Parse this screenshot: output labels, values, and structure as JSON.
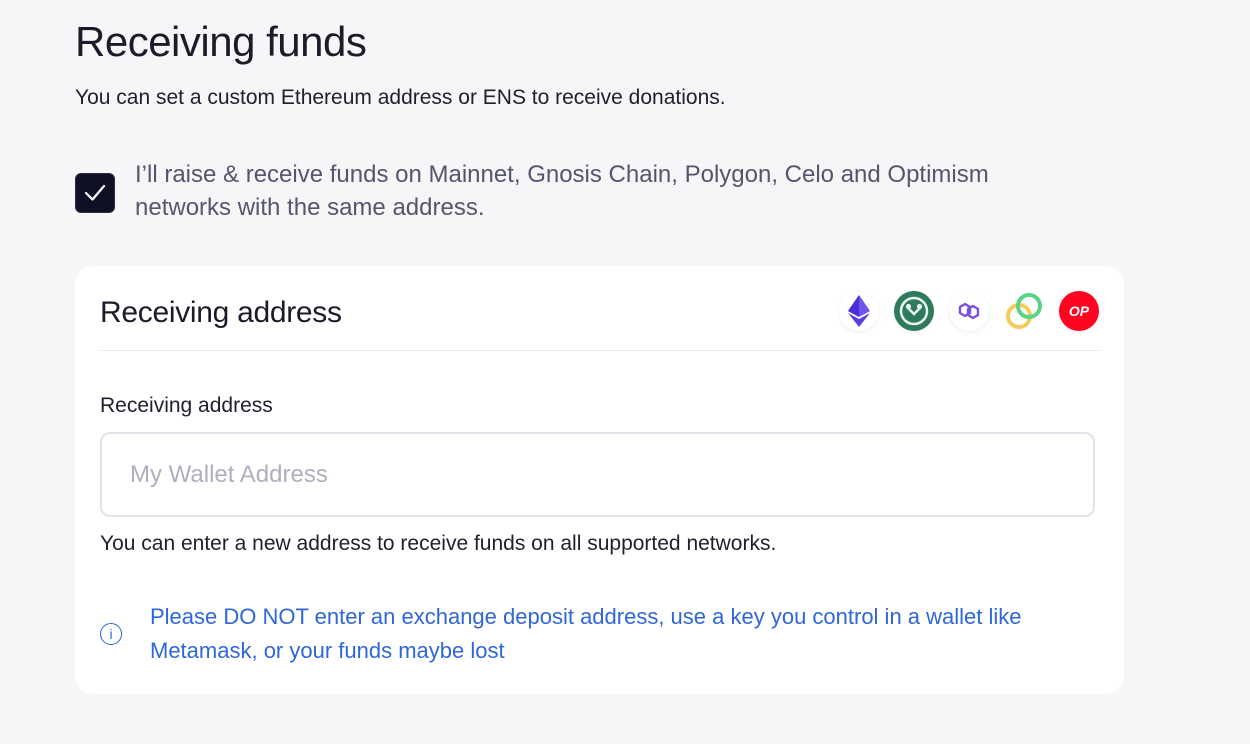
{
  "header": {
    "title": "Receiving funds",
    "subtitle": "You can set a custom Ethereum address or ENS to receive donations."
  },
  "same_address_option": {
    "checked": true,
    "label": "I’ll raise & receive funds on Mainnet, Gnosis Chain, Polygon, Celo and Optimism networks with the same address."
  },
  "card": {
    "title": "Receiving address",
    "networks": [
      {
        "icon": "ethereum-icon",
        "color": "#5b3fe3"
      },
      {
        "icon": "gnosis-icon",
        "color": "#2f7a5b"
      },
      {
        "icon": "polygon-icon",
        "color": "#7b4fe0"
      },
      {
        "icon": "celo-icon",
        "color": "#35d07f"
      },
      {
        "icon": "optimism-icon",
        "text": "OP",
        "color": "#ff0420"
      }
    ],
    "field_label": "Receiving address",
    "input_placeholder": "My Wallet Address",
    "input_value": "",
    "helper_text": "You can enter a new address to receive funds on all supported networks.",
    "warning_icon": "i",
    "warning_text": "Please DO NOT enter an exchange deposit address, use a key you control in a wallet like Metamask, or your funds maybe lost"
  },
  "colors": {
    "background": "#f6f6f8",
    "card": "#ffffff",
    "checkbox": "#0f1024",
    "warning": "#2f66d8"
  }
}
